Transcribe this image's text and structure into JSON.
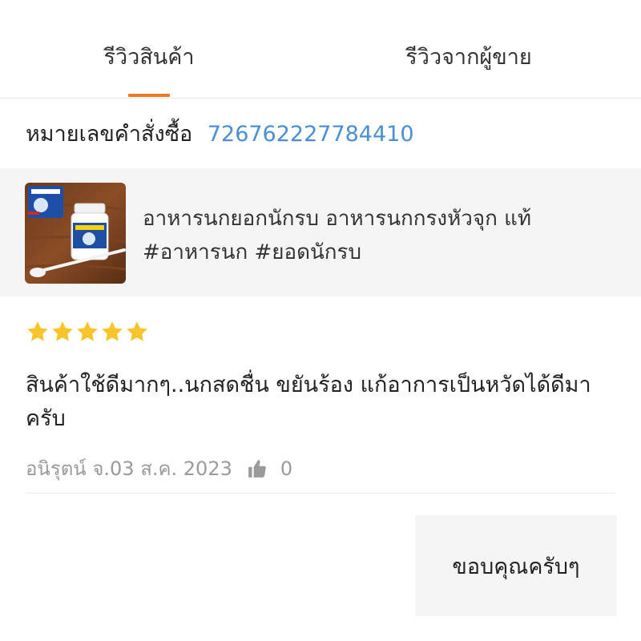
{
  "tabs": [
    {
      "label": "รีวิวสินค้า",
      "active": true
    },
    {
      "label": "รีวิวจากผู้ขาย",
      "active": false
    }
  ],
  "order": {
    "label": "หมายเลขคำสั่งซื้อ",
    "number": "726762227784410"
  },
  "product": {
    "title": "อาหารนกยอกนักรบ อาหารนกกรงหัวจุก แท้ #อาหารนก #ยอดนักรบ",
    "thumbnail_icon": "product-photo"
  },
  "review": {
    "rating": 5,
    "rating_max": 5,
    "text": "สินค้าใช้ดีมากๆ..นกสดชื่น ขยันร้อง แก้อาการเป็นหวัดได้ดีมาครับ",
    "author_date": "อนิรุตน์ จ.03 ส.ค. 2023",
    "like_icon": "thumbs-up-icon",
    "likes": "0"
  },
  "seller_reply": {
    "text": "ขอบคุณครับๆ"
  },
  "colors": {
    "accent": "#ee7a22",
    "link": "#4a8fd4",
    "star": "#f7c52a",
    "muted": "#9a9a9a",
    "panel": "#f5f5f5"
  }
}
